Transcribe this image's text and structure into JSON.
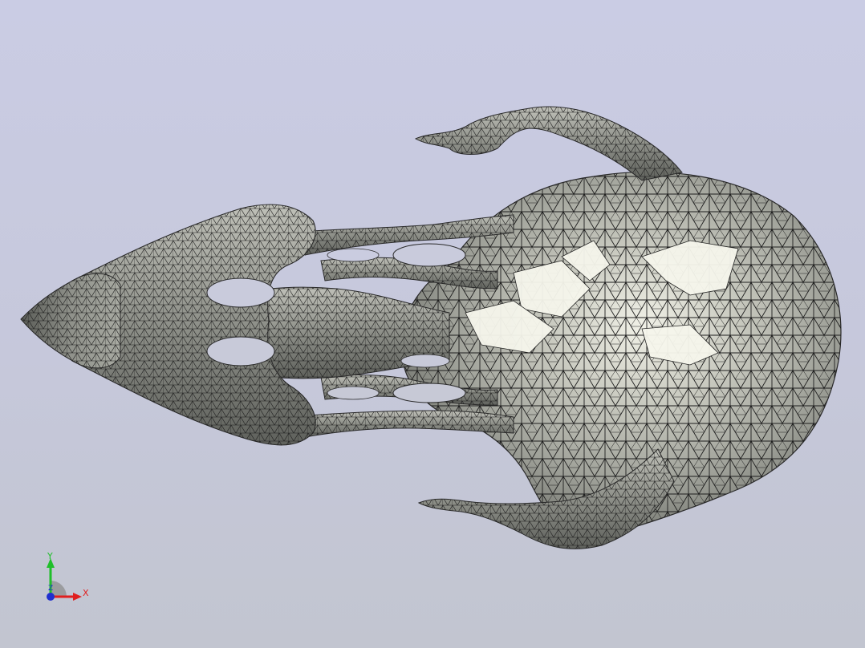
{
  "viewport": {
    "background_top": "#cacce4",
    "background_bottom": "#c2c5d0",
    "model": {
      "icon": "triangulated-mesh-model",
      "surface_color": "#9c9e96",
      "highlight_color": "#f4f4ea",
      "edge_color": "#1e1e1e"
    },
    "triad": {
      "x_label": "X",
      "y_label": "Y",
      "z_label": "Z",
      "x_color": "#e01f1f",
      "y_color": "#1fbf2a",
      "z_color": "#1f2fcf"
    }
  }
}
